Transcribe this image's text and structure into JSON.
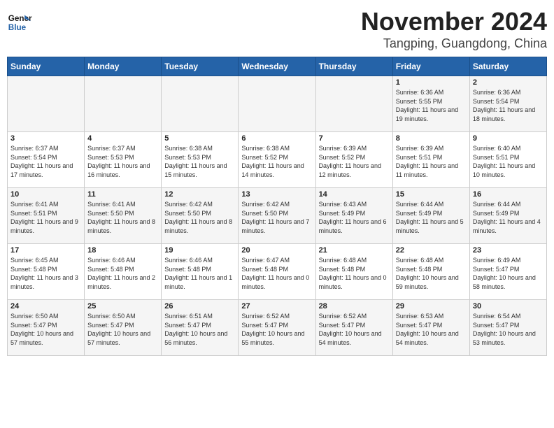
{
  "header": {
    "logo_line1": "General",
    "logo_line2": "Blue",
    "title": "November 2024",
    "subtitle": "Tangping, Guangdong, China"
  },
  "days_of_week": [
    "Sunday",
    "Monday",
    "Tuesday",
    "Wednesday",
    "Thursday",
    "Friday",
    "Saturday"
  ],
  "weeks": [
    [
      {
        "day": "",
        "info": ""
      },
      {
        "day": "",
        "info": ""
      },
      {
        "day": "",
        "info": ""
      },
      {
        "day": "",
        "info": ""
      },
      {
        "day": "",
        "info": ""
      },
      {
        "day": "1",
        "info": "Sunrise: 6:36 AM\nSunset: 5:55 PM\nDaylight: 11 hours and 19 minutes."
      },
      {
        "day": "2",
        "info": "Sunrise: 6:36 AM\nSunset: 5:54 PM\nDaylight: 11 hours and 18 minutes."
      }
    ],
    [
      {
        "day": "3",
        "info": "Sunrise: 6:37 AM\nSunset: 5:54 PM\nDaylight: 11 hours and 17 minutes."
      },
      {
        "day": "4",
        "info": "Sunrise: 6:37 AM\nSunset: 5:53 PM\nDaylight: 11 hours and 16 minutes."
      },
      {
        "day": "5",
        "info": "Sunrise: 6:38 AM\nSunset: 5:53 PM\nDaylight: 11 hours and 15 minutes."
      },
      {
        "day": "6",
        "info": "Sunrise: 6:38 AM\nSunset: 5:52 PM\nDaylight: 11 hours and 14 minutes."
      },
      {
        "day": "7",
        "info": "Sunrise: 6:39 AM\nSunset: 5:52 PM\nDaylight: 11 hours and 12 minutes."
      },
      {
        "day": "8",
        "info": "Sunrise: 6:39 AM\nSunset: 5:51 PM\nDaylight: 11 hours and 11 minutes."
      },
      {
        "day": "9",
        "info": "Sunrise: 6:40 AM\nSunset: 5:51 PM\nDaylight: 11 hours and 10 minutes."
      }
    ],
    [
      {
        "day": "10",
        "info": "Sunrise: 6:41 AM\nSunset: 5:51 PM\nDaylight: 11 hours and 9 minutes."
      },
      {
        "day": "11",
        "info": "Sunrise: 6:41 AM\nSunset: 5:50 PM\nDaylight: 11 hours and 8 minutes."
      },
      {
        "day": "12",
        "info": "Sunrise: 6:42 AM\nSunset: 5:50 PM\nDaylight: 11 hours and 8 minutes."
      },
      {
        "day": "13",
        "info": "Sunrise: 6:42 AM\nSunset: 5:50 PM\nDaylight: 11 hours and 7 minutes."
      },
      {
        "day": "14",
        "info": "Sunrise: 6:43 AM\nSunset: 5:49 PM\nDaylight: 11 hours and 6 minutes."
      },
      {
        "day": "15",
        "info": "Sunrise: 6:44 AM\nSunset: 5:49 PM\nDaylight: 11 hours and 5 minutes."
      },
      {
        "day": "16",
        "info": "Sunrise: 6:44 AM\nSunset: 5:49 PM\nDaylight: 11 hours and 4 minutes."
      }
    ],
    [
      {
        "day": "17",
        "info": "Sunrise: 6:45 AM\nSunset: 5:48 PM\nDaylight: 11 hours and 3 minutes."
      },
      {
        "day": "18",
        "info": "Sunrise: 6:46 AM\nSunset: 5:48 PM\nDaylight: 11 hours and 2 minutes."
      },
      {
        "day": "19",
        "info": "Sunrise: 6:46 AM\nSunset: 5:48 PM\nDaylight: 11 hours and 1 minute."
      },
      {
        "day": "20",
        "info": "Sunrise: 6:47 AM\nSunset: 5:48 PM\nDaylight: 11 hours and 0 minutes."
      },
      {
        "day": "21",
        "info": "Sunrise: 6:48 AM\nSunset: 5:48 PM\nDaylight: 11 hours and 0 minutes."
      },
      {
        "day": "22",
        "info": "Sunrise: 6:48 AM\nSunset: 5:48 PM\nDaylight: 10 hours and 59 minutes."
      },
      {
        "day": "23",
        "info": "Sunrise: 6:49 AM\nSunset: 5:47 PM\nDaylight: 10 hours and 58 minutes."
      }
    ],
    [
      {
        "day": "24",
        "info": "Sunrise: 6:50 AM\nSunset: 5:47 PM\nDaylight: 10 hours and 57 minutes."
      },
      {
        "day": "25",
        "info": "Sunrise: 6:50 AM\nSunset: 5:47 PM\nDaylight: 10 hours and 57 minutes."
      },
      {
        "day": "26",
        "info": "Sunrise: 6:51 AM\nSunset: 5:47 PM\nDaylight: 10 hours and 56 minutes."
      },
      {
        "day": "27",
        "info": "Sunrise: 6:52 AM\nSunset: 5:47 PM\nDaylight: 10 hours and 55 minutes."
      },
      {
        "day": "28",
        "info": "Sunrise: 6:52 AM\nSunset: 5:47 PM\nDaylight: 10 hours and 54 minutes."
      },
      {
        "day": "29",
        "info": "Sunrise: 6:53 AM\nSunset: 5:47 PM\nDaylight: 10 hours and 54 minutes."
      },
      {
        "day": "30",
        "info": "Sunrise: 6:54 AM\nSunset: 5:47 PM\nDaylight: 10 hours and 53 minutes."
      }
    ]
  ]
}
